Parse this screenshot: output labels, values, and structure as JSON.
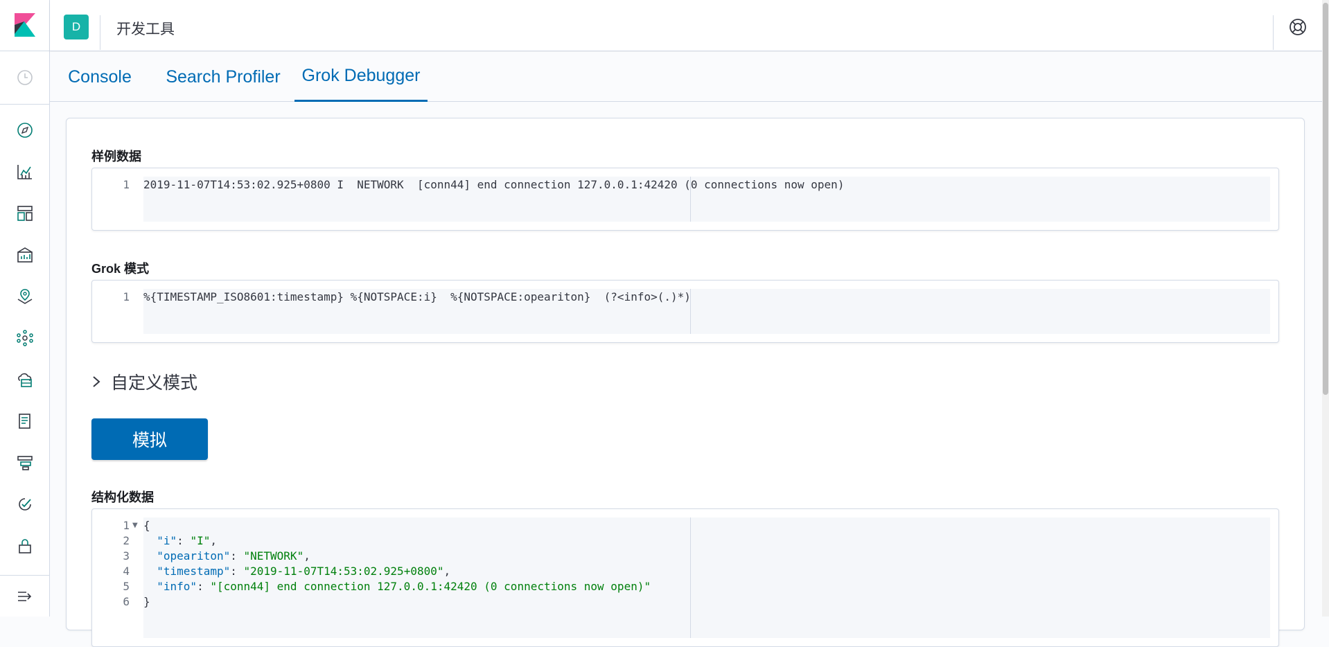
{
  "header": {
    "avatar_letter": "D",
    "title": "开发工具"
  },
  "tabs": [
    {
      "label": "Console"
    },
    {
      "label": "Search Profiler"
    },
    {
      "label": "Grok Debugger",
      "active": true
    }
  ],
  "sample": {
    "label": "样例数据",
    "lines": [
      "2019-11-07T14:53:02.925+0800 I  NETWORK  [conn44] end connection 127.0.0.1:42420 (0 connections now open)"
    ]
  },
  "pattern": {
    "label": "Grok 模式",
    "lines": [
      "%{TIMESTAMP_ISO8601:timestamp} %{NOTSPACE:i}  %{NOTSPACE:opeariton}  (?<info>(.)*)"
    ]
  },
  "custom_patterns": {
    "label": "自定义模式"
  },
  "simulate_button": {
    "label": "模拟"
  },
  "structured": {
    "label": "结构化数据",
    "line_numbers": [
      "1",
      "2",
      "3",
      "4",
      "5",
      "6"
    ],
    "open_brace": "{",
    "close_brace": "}",
    "entries": [
      {
        "key": "\"i\"",
        "value": "\"I\"",
        "trail": ","
      },
      {
        "key": "\"opeariton\"",
        "value": "\"NETWORK\"",
        "trail": ","
      },
      {
        "key": "\"timestamp\"",
        "value": "\"2019-11-07T14:53:02.925+0800\"",
        "trail": ","
      },
      {
        "key": "\"info\"",
        "value": "\"[conn44] end connection 127.0.0.1:42420 (0 connections now open)\"",
        "trail": ""
      }
    ]
  },
  "line_one": "1",
  "colors": {
    "accent": "#006bb4",
    "avatar": "#17b3a8",
    "json_key": "#006bb4",
    "json_string": "#00800c"
  }
}
